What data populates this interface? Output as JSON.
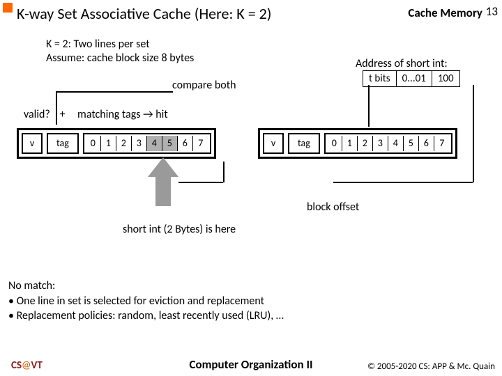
{
  "title": "K-way Set Associative Cache (Here: K = 2)",
  "header_right": "Cache Memory",
  "page_num": "13",
  "assume_l1": "K = 2: Two lines per set",
  "assume_l2": "Assume: cache block size 8 bytes",
  "addr_label": "Address of short int:",
  "addr": {
    "a": "t bits",
    "b": "0...01",
    "c": "100"
  },
  "compare": "compare both",
  "valid": "valid?",
  "plus": "+",
  "matching": "matching tags → hit",
  "v": "v",
  "tag": "tag",
  "d0": "0",
  "d1": "1",
  "d2": "2",
  "d3": "3",
  "d4": "4",
  "d5": "5",
  "d6": "6",
  "d7": "7",
  "blockoff": "block offset",
  "shortint": "short int (2 Bytes) is here",
  "nomatch_h": "No match:",
  "nomatch_1": "• One line in set is selected for eviction and replacement",
  "nomatch_2": "• Replacement policies: random, least recently used (LRU), …",
  "foot_cs": "CS",
  "foot_at": "@",
  "foot_vt": "VT",
  "foot_c": "Computer Organization II",
  "foot_r": "© 2005-2020 CS: APP & Mc. Quain"
}
